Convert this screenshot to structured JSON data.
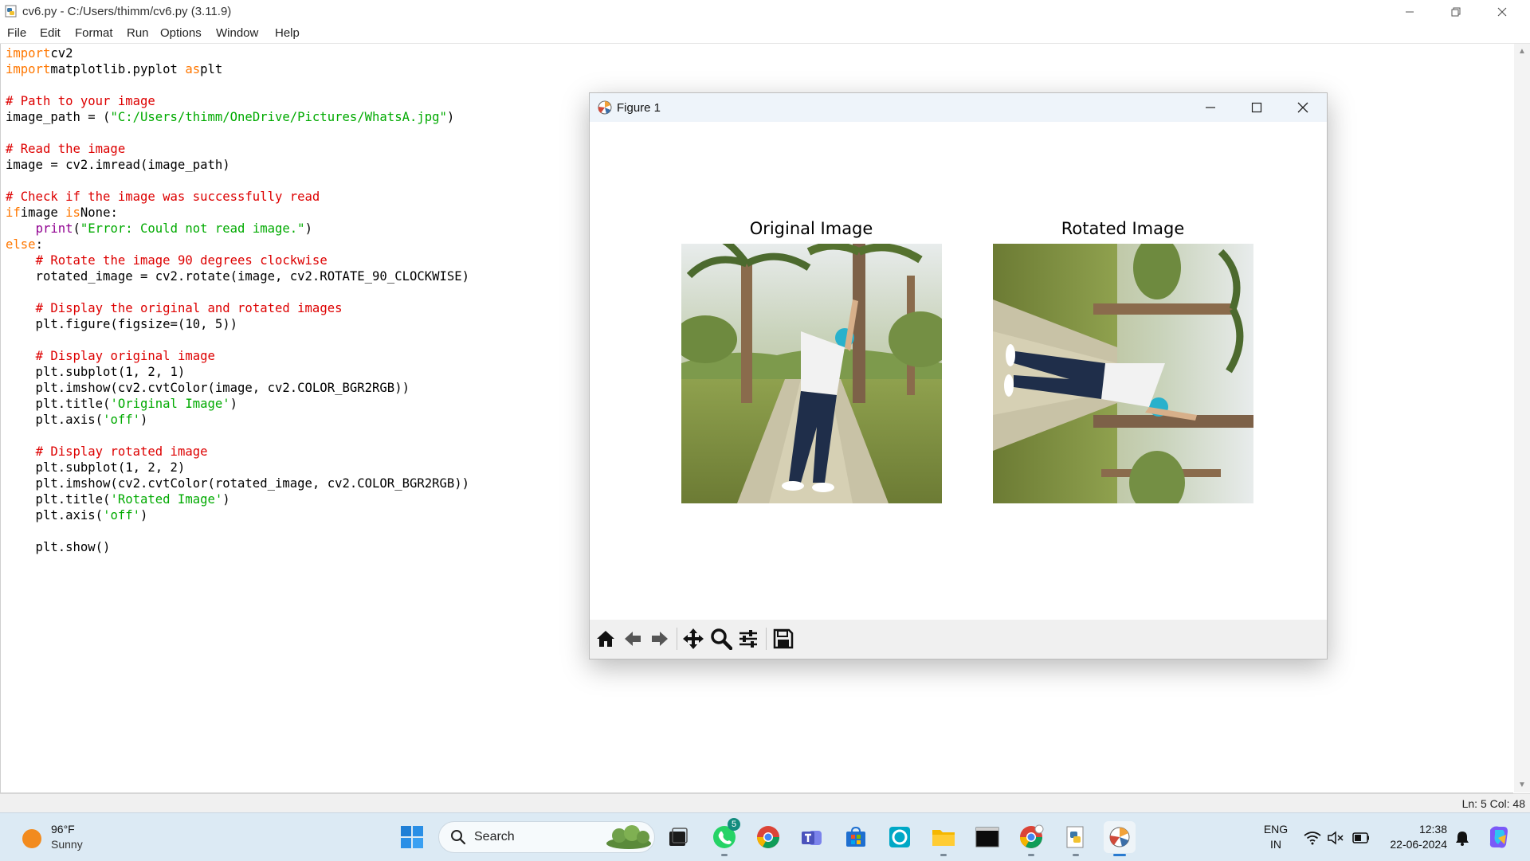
{
  "idle": {
    "title": "cv6.py - C:/Users/thimm/cv6.py (3.11.9)",
    "menu": [
      "File",
      "Edit",
      "Format",
      "Run",
      "Options",
      "Window",
      "Help"
    ],
    "status": "Ln: 5   Col: 48"
  },
  "code_lines": [
    [
      [
        "kw",
        "import"
      ],
      [
        "",
        "cv2"
      ]
    ],
    [
      [
        "kw",
        "import"
      ],
      [
        "",
        "matplotlib.pyplot "
      ],
      [
        "kw",
        "as"
      ],
      [
        "",
        "plt"
      ]
    ],
    [],
    [
      [
        "cm",
        "# Path to your image"
      ]
    ],
    [
      [
        "",
        "image_path = ("
      ],
      [
        "st",
        "\"C:/Users/thimm/OneDrive/Pictures/WhatsA.jpg\""
      ],
      [
        "",
        ")"
      ]
    ],
    [],
    [
      [
        "cm",
        "# Read the image"
      ]
    ],
    [
      [
        "",
        "image = cv2.imread(image_path)"
      ]
    ],
    [],
    [
      [
        "cm",
        "# Check if the image was successfully read"
      ]
    ],
    [
      [
        "kw",
        "if"
      ],
      [
        "",
        "image "
      ],
      [
        "kw",
        "is"
      ],
      [
        "",
        "None:"
      ]
    ],
    [
      [
        "",
        "    "
      ],
      [
        "bi",
        "print"
      ],
      [
        "",
        "("
      ],
      [
        "st",
        "\"Error: Could not read image.\""
      ],
      [
        "",
        ")"
      ]
    ],
    [
      [
        "kw",
        "else"
      ],
      [
        "",
        ":"
      ]
    ],
    [
      [
        "",
        "    "
      ],
      [
        "cm",
        "# Rotate the image 90 degrees clockwise"
      ]
    ],
    [
      [
        "",
        "    rotated_image = cv2.rotate(image, cv2.ROTATE_90_CLOCKWISE)"
      ]
    ],
    [],
    [
      [
        "",
        "    "
      ],
      [
        "cm",
        "# Display the original and rotated images"
      ]
    ],
    [
      [
        "",
        "    plt.figure(figsize=(10, 5))"
      ]
    ],
    [],
    [
      [
        "",
        "    "
      ],
      [
        "cm",
        "# Display original image"
      ]
    ],
    [
      [
        "",
        "    plt.subplot(1, 2, 1)"
      ]
    ],
    [
      [
        "",
        "    plt.imshow(cv2.cvtColor(image, cv2.COLOR_BGR2RGB))"
      ]
    ],
    [
      [
        "",
        "    plt.title("
      ],
      [
        "st",
        "'Original Image'"
      ],
      [
        "",
        ")"
      ]
    ],
    [
      [
        "",
        "    plt.axis("
      ],
      [
        "st",
        "'off'"
      ],
      [
        "",
        ")"
      ]
    ],
    [],
    [
      [
        "",
        "    "
      ],
      [
        "cm",
        "# Display rotated image"
      ]
    ],
    [
      [
        "",
        "    plt.subplot(1, 2, 2)"
      ]
    ],
    [
      [
        "",
        "    plt.imshow(cv2.cvtColor(rotated_image, cv2.COLOR_BGR2RGB))"
      ]
    ],
    [
      [
        "",
        "    plt.title("
      ],
      [
        "st",
        "'Rotated Image'"
      ],
      [
        "",
        ")"
      ]
    ],
    [
      [
        "",
        "    plt.axis("
      ],
      [
        "st",
        "'off'"
      ],
      [
        "",
        ")"
      ]
    ],
    [],
    [
      [
        "",
        "    plt.show()"
      ]
    ]
  ],
  "figure": {
    "title": "Figure 1",
    "subplot_titles": [
      "Original Image",
      "Rotated Image"
    ],
    "toolbar_icons": [
      "home-icon",
      "back-icon",
      "forward-icon",
      "pan-icon",
      "zoom-icon",
      "configure-subplots-icon",
      "save-icon"
    ]
  },
  "taskbar": {
    "weather_temp": "96°F",
    "weather_cond": "Sunny",
    "search_label": "Search",
    "whatsapp_badge": "5",
    "lang_top": "ENG",
    "lang_bottom": "IN",
    "time": "12:38",
    "date": "22-06-2024"
  },
  "colors": {
    "keyword": "#ff7700",
    "comment": "#dd0000",
    "string": "#00aa00",
    "builtin": "#900090",
    "taskbar": "#dceaf4"
  }
}
